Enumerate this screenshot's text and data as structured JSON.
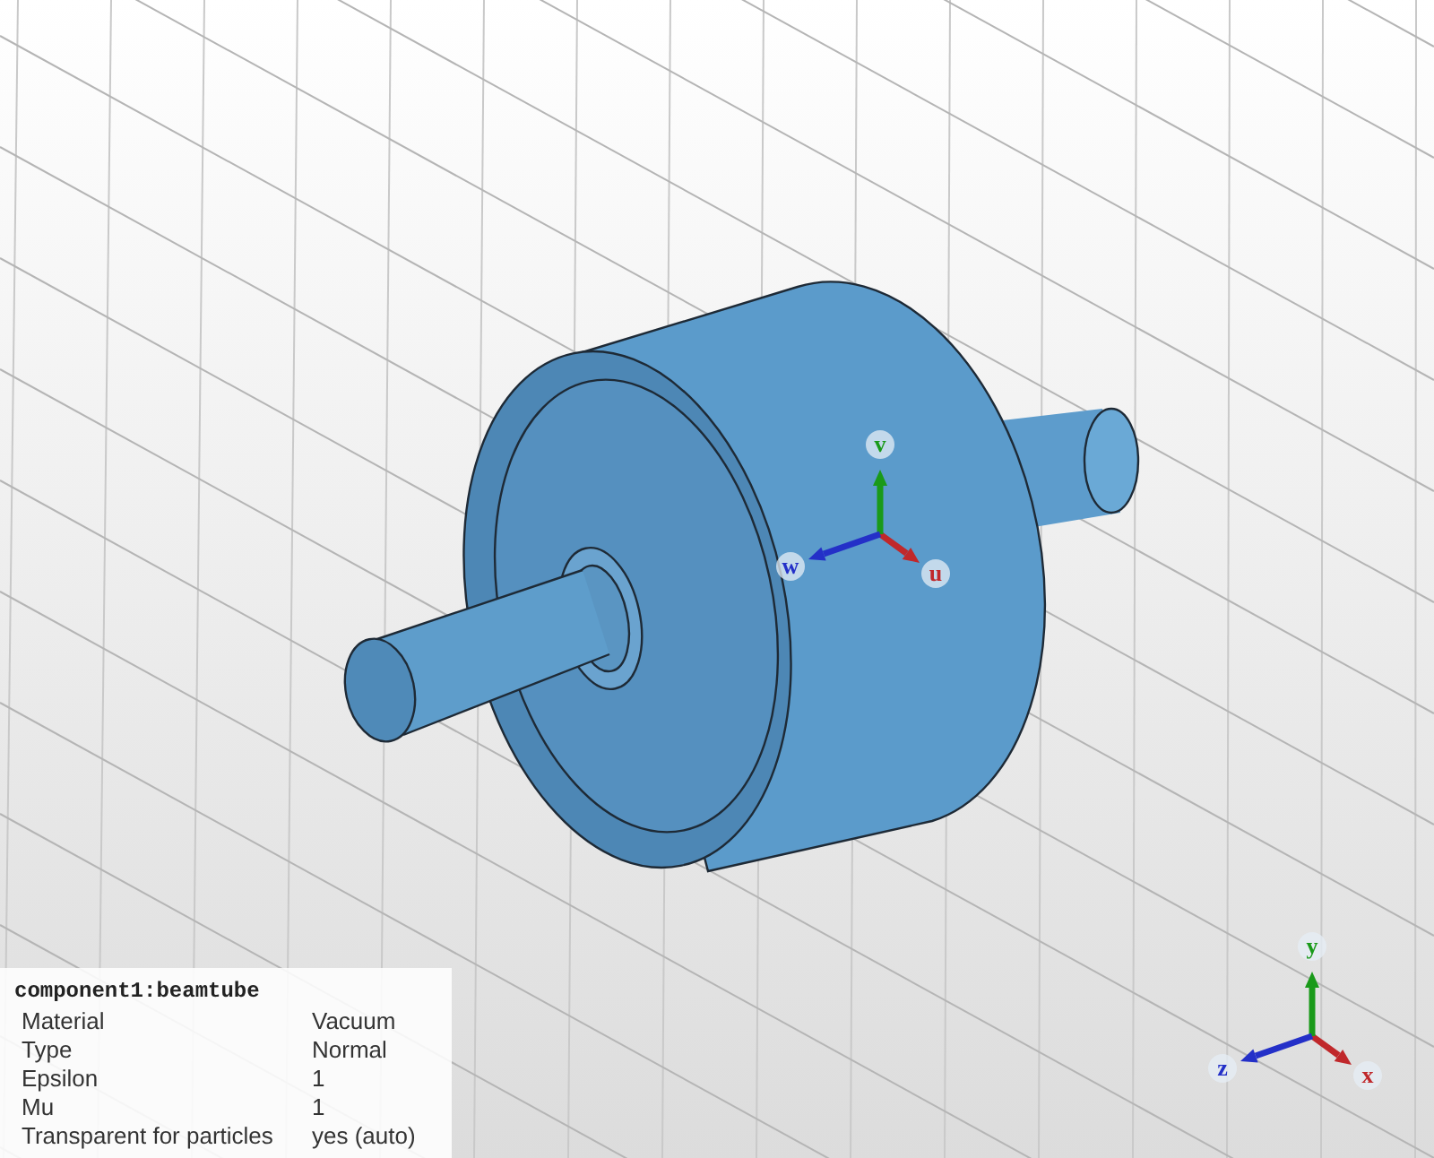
{
  "local_axes": [
    "u",
    "v",
    "w"
  ],
  "global_axes": [
    "x",
    "y",
    "z"
  ],
  "info_panel": {
    "title": "component1:beamtube",
    "rows": [
      {
        "label": "Material",
        "value": "Vacuum"
      },
      {
        "label": "Type",
        "value": "Normal"
      },
      {
        "label": "Epsilon",
        "value": "1"
      },
      {
        "label": "Mu",
        "value": "1"
      },
      {
        "label": "Transparent for particles",
        "value": "yes (auto)"
      }
    ]
  }
}
